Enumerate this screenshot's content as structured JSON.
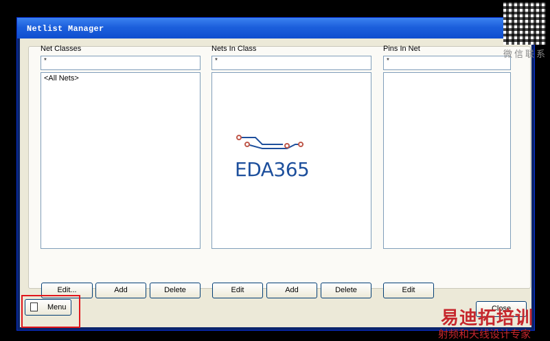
{
  "window": {
    "title": "Netlist Manager",
    "help_glyph": "?",
    "close_glyph": "✕"
  },
  "columns": [
    {
      "label": "Net Classes",
      "filter": "*",
      "items": [
        "<All Nets>"
      ],
      "buttons": [
        "Edit...",
        "Add",
        "Delete"
      ]
    },
    {
      "label": "Nets In Class",
      "filter": "*",
      "items": [],
      "buttons": [
        "Edit",
        "Add",
        "Delete"
      ]
    },
    {
      "label": "Pins In Net",
      "filter": "*",
      "items": [],
      "buttons": [
        "Edit"
      ]
    }
  ],
  "footer": {
    "menu_label": "Menu",
    "close_label": "Close"
  },
  "logo": {
    "text": "EDA365",
    "color": "#1d4f9c",
    "accent": "#c0584a"
  },
  "watermark": {
    "qr_caption": "微信联系",
    "line1": "易迪拓培训",
    "line2": "射频和天线设计专家",
    "color": "#c6272d"
  },
  "highlight_color": "#e0151b"
}
